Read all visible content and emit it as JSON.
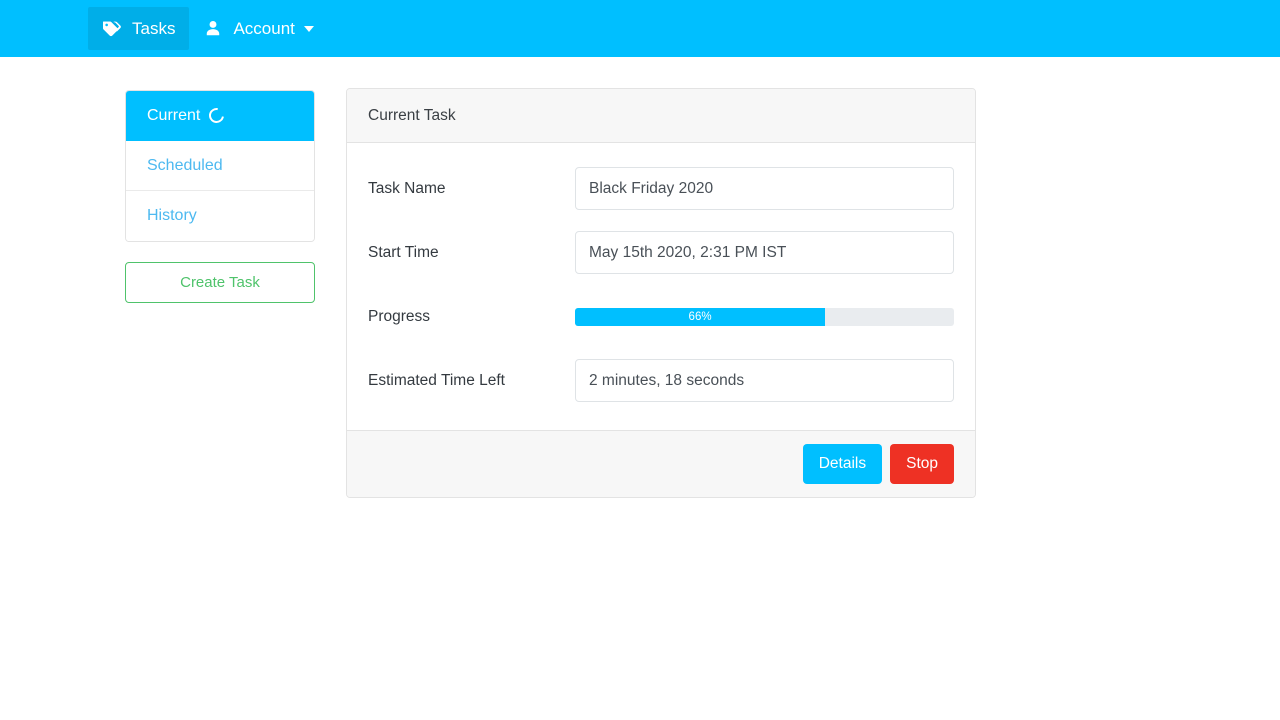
{
  "navbar": {
    "background": "#00bfff",
    "items": [
      {
        "label": "Tasks",
        "icon": "tags-icon",
        "active": true
      },
      {
        "label": "Account",
        "icon": "user-icon",
        "active": false,
        "caret": true
      }
    ]
  },
  "sidebar": {
    "items": [
      {
        "label": "Current",
        "active": true,
        "spinner": true
      },
      {
        "label": "Scheduled",
        "active": false,
        "spinner": false
      },
      {
        "label": "History",
        "active": false,
        "spinner": false
      }
    ],
    "create_button": {
      "label": "Create Task",
      "border_color": "#4fc36b",
      "text_color": "#4fc36b"
    }
  },
  "card": {
    "header_title": "Current Task",
    "fields": [
      {
        "label": "Task Name",
        "value": "Black Friday 2020",
        "placeholder": "Task Name"
      },
      {
        "label": "Start Time",
        "value": "May 15th 2020, 2:31 PM IST",
        "placeholder": "Start Time"
      },
      {
        "label": "Estimated Time Left",
        "value": "2 minutes, 18 seconds",
        "placeholder": "Estimated Time Left"
      }
    ],
    "progress": {
      "label": "Progress",
      "percent": 66,
      "text": "66%",
      "fill_color": "#00bfff",
      "track_color": "#e9ecef"
    },
    "footer": {
      "details_label": "Details",
      "details_color": "#00bfff",
      "stop_label": "Stop",
      "stop_color": "#ee3124"
    }
  }
}
